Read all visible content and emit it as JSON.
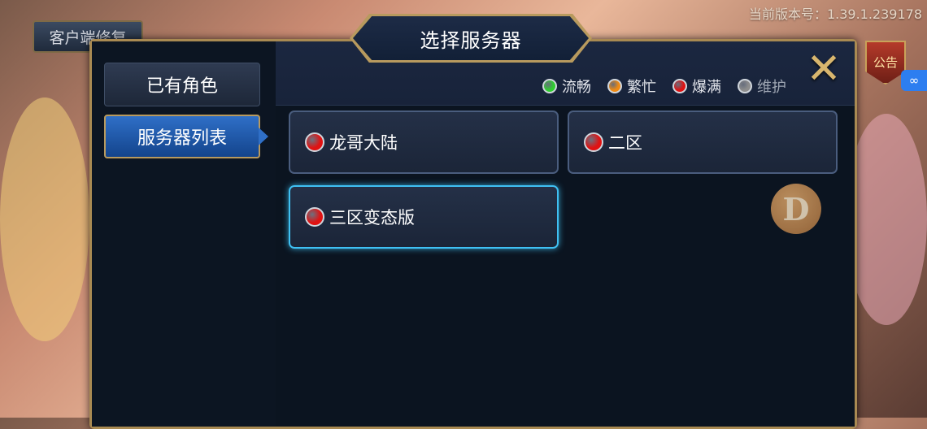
{
  "version_text": "当前版本号：1.39.1.239178",
  "repair_button_label": "客户端修复",
  "notice_badge_label": "公告",
  "side_pill_label": "∞",
  "dialog": {
    "title": "选择服务器",
    "close_glyph": "✕"
  },
  "tabs": [
    {
      "label": "已有角色",
      "active": false
    },
    {
      "label": "服务器列表",
      "active": true
    }
  ],
  "legend": [
    {
      "label": "流畅",
      "color": "#2fcf2f"
    },
    {
      "label": "繁忙",
      "color": "#f08a12"
    },
    {
      "label": "爆满",
      "color": "#e01212"
    },
    {
      "label": "维护",
      "color": "#8d8d8d"
    }
  ],
  "servers": [
    {
      "name": "龙哥大陆",
      "status_color": "#e01212",
      "selected": false
    },
    {
      "name": "二区",
      "status_color": "#e01212",
      "selected": false
    },
    {
      "name": "三区变态版",
      "status_color": "#e01212",
      "selected": true
    }
  ],
  "coin_letter": "D"
}
